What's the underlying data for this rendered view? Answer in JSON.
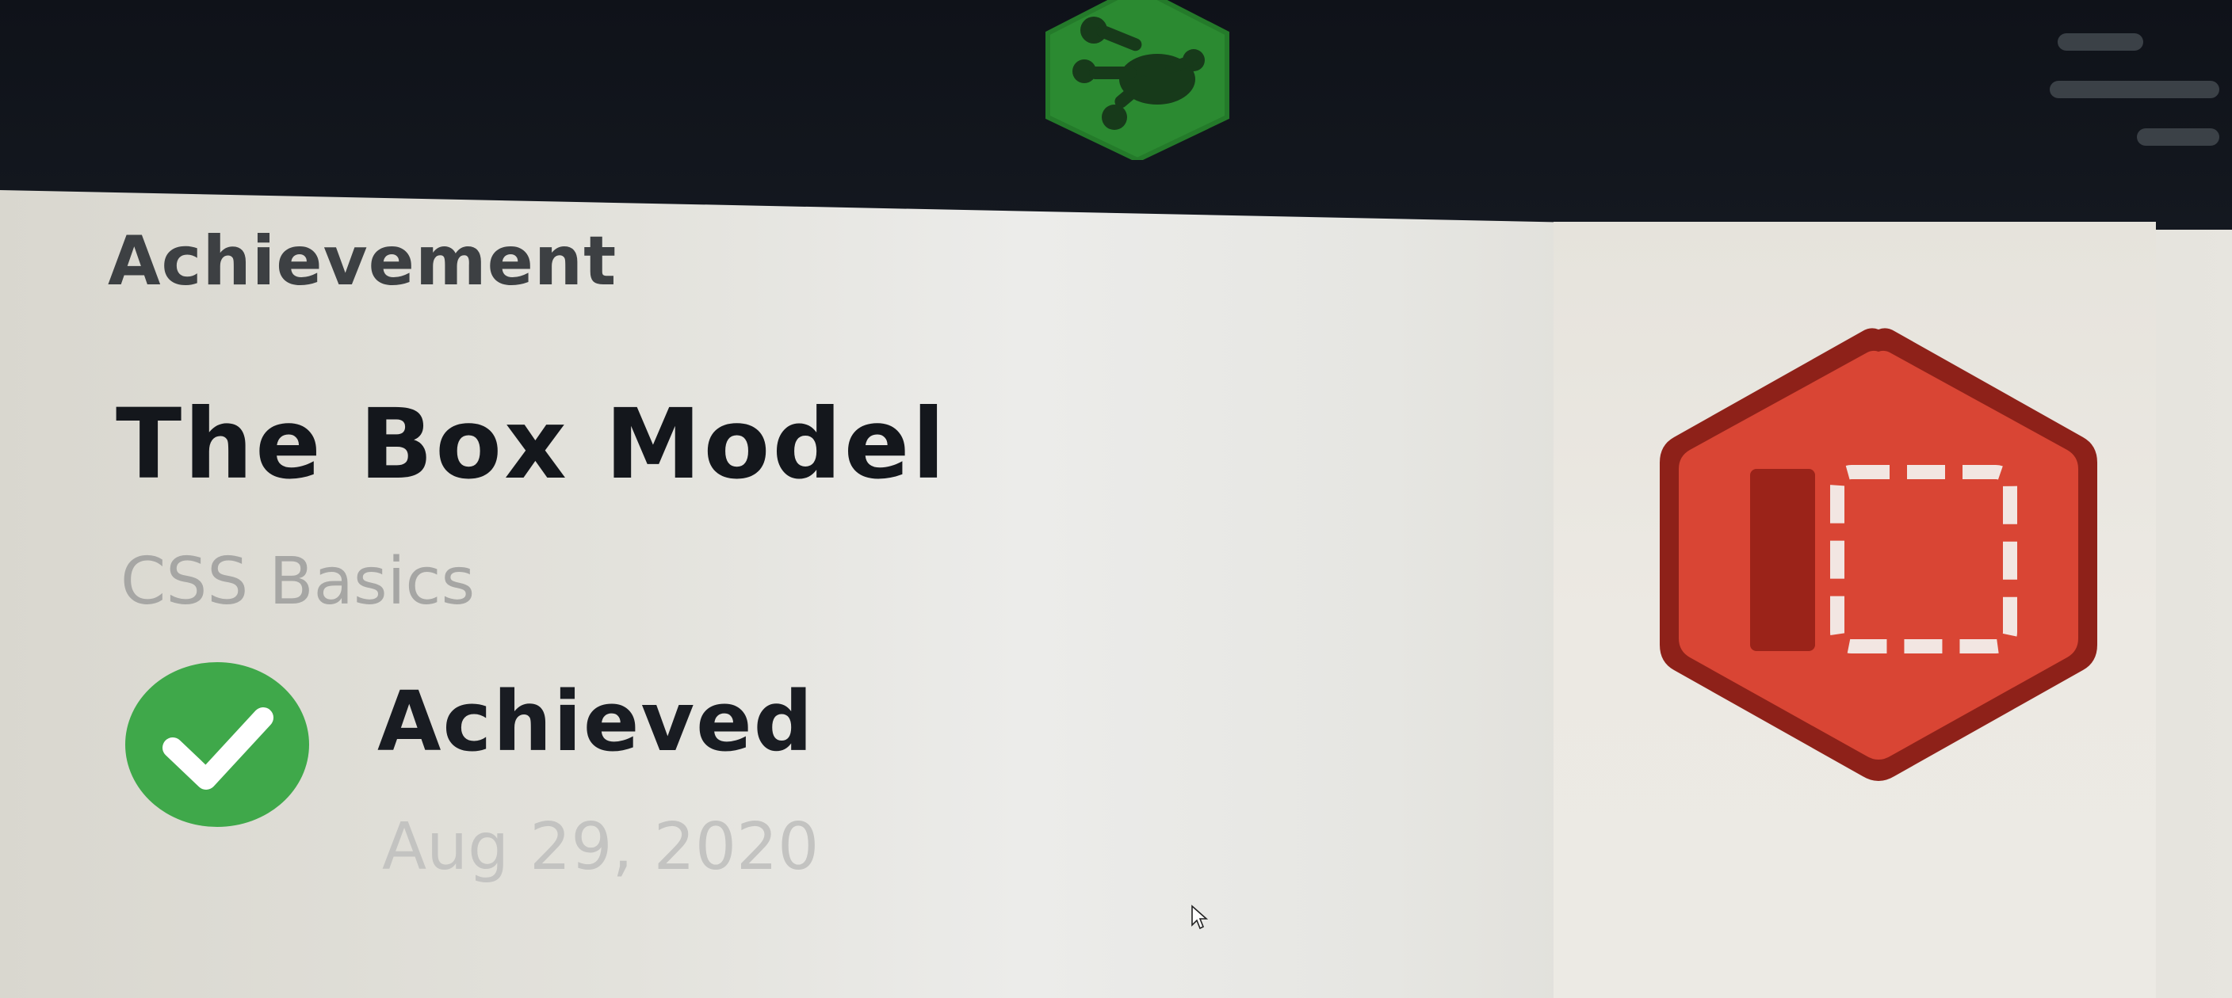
{
  "header": {
    "logo_icon": "treehouse-frog-logo",
    "menu_icon": "hamburger-menu-icon",
    "brand_color": "#2e8b32"
  },
  "achievement": {
    "section_label": "Achievement",
    "title": "The Box Model",
    "course": "CSS Basics",
    "status": "Achieved",
    "date": "Aug 29, 2020",
    "status_icon": "checkmark-icon",
    "status_color": "#3fa84a",
    "badge_icon": "box-model-badge-icon",
    "badge_color": "#d94534"
  }
}
